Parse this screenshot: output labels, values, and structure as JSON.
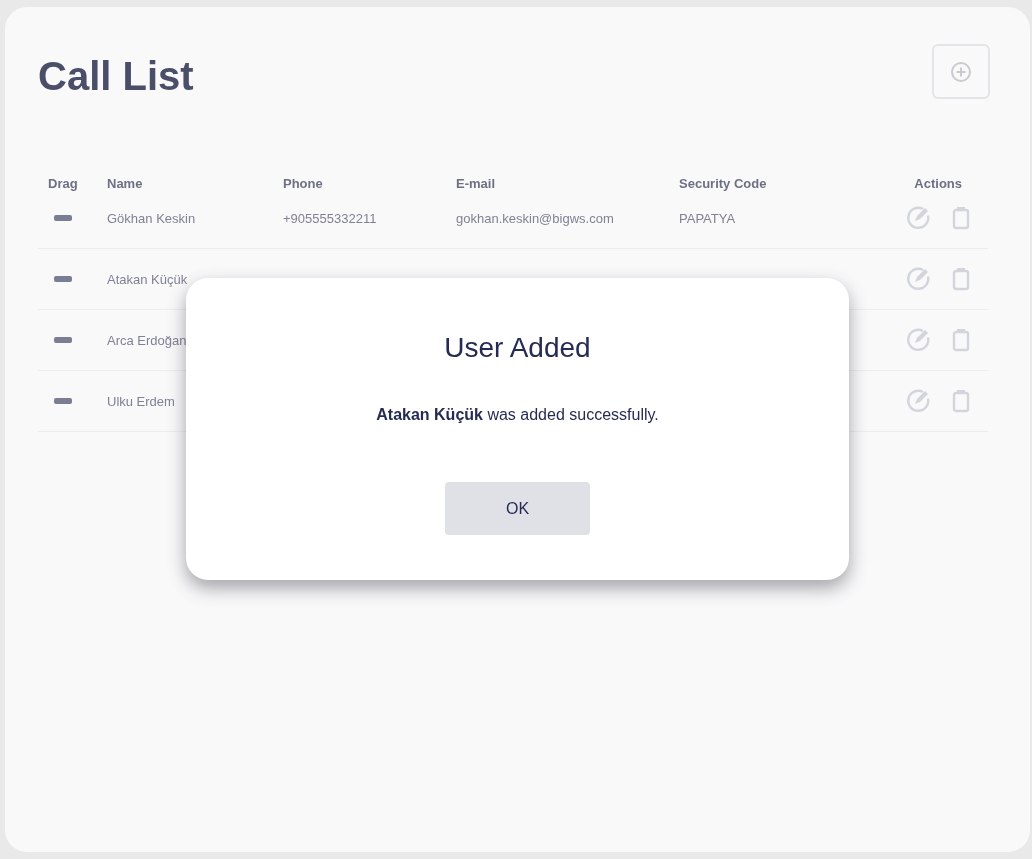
{
  "page": {
    "title": "Call List"
  },
  "table": {
    "columns": [
      "Drag",
      "Name",
      "Phone",
      "E-mail",
      "Security Code",
      "Actions"
    ],
    "rows": [
      {
        "name": "Gökhan Keskin",
        "phone": "+905555332211",
        "email": "gokhan.keskin@bigws.com",
        "security_code": "PAPATYA"
      },
      {
        "name": "Atakan Küçük"
      },
      {
        "name": "Arca Erdoğan"
      },
      {
        "name": "Ulku Erdem"
      }
    ]
  },
  "dialog": {
    "title": "User Added",
    "message": "**Atakan Küçük** was added successfully.",
    "button": "OK"
  }
}
